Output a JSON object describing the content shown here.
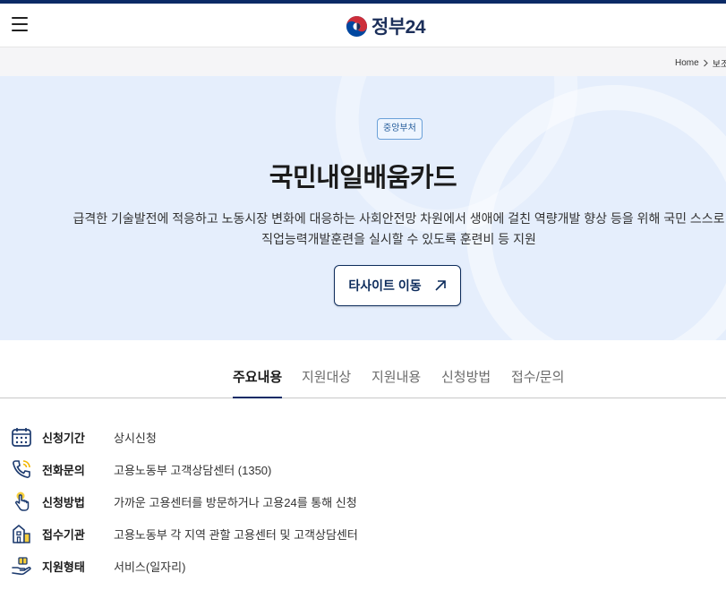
{
  "header": {
    "menu_icon": "hamburger-icon",
    "logo_text": "정부24",
    "logo_colors": {
      "red": "#cd2e3a",
      "blue": "#0047a0"
    }
  },
  "breadcrumb": {
    "home": "Home",
    "separator_icon": "chevron-right-icon",
    "current": "보조"
  },
  "hero": {
    "badge": "중앙부처",
    "title": "국민내일배움카드",
    "description_line1": "급격한 기술발전에 적응하고 노동시장 변화에 대응하는 사회안전망 차원에서 생애에 걸친 역량개발 향상 등을 위해 국민 스스로",
    "description_line2": "직업능력개발훈련을 실시할 수 있도록 훈련비 등 지원",
    "button_label": "타사이트 이동",
    "button_icon": "arrow-up-right-icon",
    "background": "#e5eefc"
  },
  "tabs": [
    {
      "label": "주요내용",
      "active": true
    },
    {
      "label": "지원대상",
      "active": false
    },
    {
      "label": "지원내용",
      "active": false
    },
    {
      "label": "신청방법",
      "active": false
    },
    {
      "label": "접수/문의",
      "active": false
    }
  ],
  "info": [
    {
      "icon": "calendar-icon",
      "label": "신청기간",
      "value": "상시신청"
    },
    {
      "icon": "phone-icon",
      "label": "전화문의",
      "value": "고용노동부 고객상담센터 (1350)"
    },
    {
      "icon": "touch-hand-icon",
      "label": "신청방법",
      "value": "가까운 고용센터를 방문하거나 고용24를 통해 신청"
    },
    {
      "icon": "building-icon",
      "label": "접수기관",
      "value": "고용노동부 각 지역 관할 고용센터 및 고객상담센터"
    },
    {
      "icon": "hand-gift-icon",
      "label": "지원형태",
      "value": "서비스(일자리)"
    }
  ]
}
